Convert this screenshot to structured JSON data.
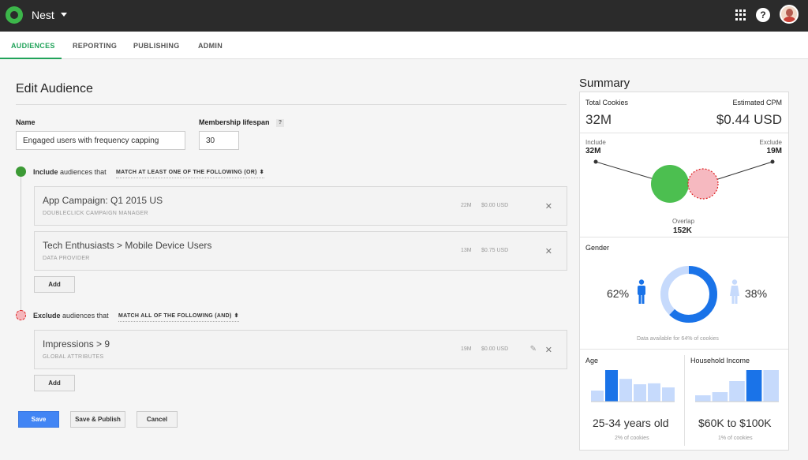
{
  "app": {
    "title": "Nest"
  },
  "nav": {
    "tabs": [
      {
        "label": "AUDIENCES",
        "active": true
      },
      {
        "label": "REPORTING"
      },
      {
        "label": "PUBLISHING"
      },
      {
        "label": "ADMIN"
      }
    ]
  },
  "edit": {
    "title": "Edit Audience",
    "name_label": "Name",
    "name_value": "Engaged users with frequency capping",
    "lifespan_label": "Membership lifespan",
    "lifespan_help": "?",
    "lifespan_value": "30",
    "include": {
      "keyword": "Include",
      "text": "audiences that",
      "match": "MATCH AT LEAST ONE OF THE FOLLOWING (OR)",
      "items": [
        {
          "name": "App Campaign: Q1 2015 US",
          "source": "DOUBLECLICK CAMPAIGN MANAGER",
          "size": "22M",
          "cost": "$0.00 USD"
        },
        {
          "name": "Tech Enthusiasts > Mobile Device Users",
          "source": "DATA PROVIDER",
          "size": "13M",
          "cost": "$0.75 USD"
        }
      ],
      "add_label": "Add"
    },
    "exclude": {
      "keyword": "Exclude",
      "text": "audiences that",
      "match": "MATCH ALL OF THE FOLLOWING (AND)",
      "items": [
        {
          "name": "Impressions > 9",
          "source": "GLOBAL ATTRIBUTES",
          "size": "19M",
          "cost": "$0.00 USD"
        }
      ],
      "add_label": "Add"
    },
    "buttons": {
      "save": "Save",
      "save_publish": "Save & Publish",
      "cancel": "Cancel"
    }
  },
  "summary": {
    "title": "Summary",
    "total_cookies_label": "Total Cookies",
    "total_cookies": "32M",
    "cpm_label": "Estimated CPM",
    "cpm": "$0.44 USD",
    "include_label": "Include",
    "include_value": "32M",
    "exclude_label": "Exclude",
    "exclude_value": "19M",
    "overlap_label": "Overlap",
    "overlap_value": "152K",
    "gender_label": "Gender",
    "male_pct": "62%",
    "female_pct": "38%",
    "male_fraction": 0.62,
    "gender_note": "Data available for 64% of cookies",
    "age_label": "Age",
    "age_value": "25-34 years old",
    "age_note": "2% of cookies",
    "age_bars": [
      0.35,
      1.0,
      0.72,
      0.55,
      0.58,
      0.45
    ],
    "age_highlight": 1,
    "income_label": "Household Income",
    "income_value": "$60K to $100K",
    "income_note": "1% of cookies",
    "income_bars": [
      0.2,
      0.3,
      0.65,
      1.0,
      1.0
    ],
    "income_highlight": 3,
    "colors": {
      "green": "#21a35a",
      "include": "#4cbf50",
      "exclude": "#f6b9c0",
      "blue": "#1a73e8",
      "light_blue": "#c6dafc"
    }
  }
}
